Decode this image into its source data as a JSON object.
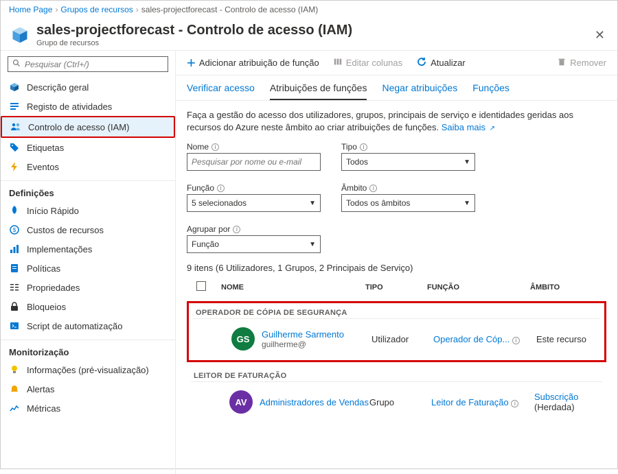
{
  "breadcrumb": {
    "home": "Home Page",
    "group": "Grupos de recursos",
    "current": "sales-projectforecast - Controlo de acesso (IAM)"
  },
  "header": {
    "title": "sales-projectforecast - Controlo de acesso (IAM)",
    "subtitle": "Grupo de recursos"
  },
  "search": {
    "placeholder": "Pesquisar (Ctrl+/)"
  },
  "nav": {
    "items": [
      {
        "label": "Descrição geral"
      },
      {
        "label": "Registo de atividades"
      },
      {
        "label": "Controlo de acesso (IAM)"
      },
      {
        "label": "Etiquetas"
      },
      {
        "label": "Eventos"
      }
    ],
    "section_def": "Definições",
    "def_items": [
      {
        "label": "Início Rápido"
      },
      {
        "label": "Custos de recursos"
      },
      {
        "label": "Implementações"
      },
      {
        "label": "Políticas"
      },
      {
        "label": "Propriedades"
      },
      {
        "label": "Bloqueios"
      },
      {
        "label": "Script de automatização"
      }
    ],
    "section_mon": "Monitorização",
    "mon_items": [
      {
        "label": "Informações (pré-visualização)"
      },
      {
        "label": "Alertas"
      },
      {
        "label": "Métricas"
      }
    ]
  },
  "toolbar": {
    "add": "Adicionar atribuição de função",
    "edit": "Editar colunas",
    "refresh": "Atualizar",
    "remove": "Remover"
  },
  "tabs": {
    "verify": "Verificar acesso",
    "assign": "Atribuições de funções",
    "deny": "Negar atribuições",
    "roles": "Funções"
  },
  "desc": {
    "text": "Faça a gestão do acesso dos utilizadores, grupos, principais de serviço e identidades geridas aos recursos do Azure neste âmbito ao criar atribuições de funções. ",
    "link": "Saiba mais"
  },
  "filters": {
    "nome_label": "Nome",
    "nome_placeholder": "Pesquisar por nome ou e-mail",
    "tipo_label": "Tipo",
    "tipo_value": "Todos",
    "funcao_label": "Função",
    "funcao_value": "5 selecionados",
    "ambito_label": "Âmbito",
    "ambito_value": "Todos os âmbitos",
    "agrupar_label": "Agrupar por",
    "agrupar_value": "Função"
  },
  "summary": "9 itens (6 Utilizadores, 1 Grupos, 2 Principais de Serviço)",
  "cols": {
    "nome": "Nome",
    "tipo": "Tipo",
    "funcao": "Função",
    "ambito": "Âmbito"
  },
  "group1": {
    "title": "OPERADOR DE CÓPIA DE SEGURANÇA",
    "avatar": "GS",
    "name": "Guilherme Sarmento",
    "email": "guilherme@",
    "tipo": "Utilizador",
    "funcao": "Operador de Cóp...",
    "ambito": "Este recurso"
  },
  "group2": {
    "title": "LEITOR DE FATURAÇÃO",
    "avatar": "AV",
    "name": "Administradores de Vendas",
    "tipo": "Grupo",
    "funcao": "Leitor de Faturação",
    "ambito_link": "Subscrição",
    "ambito_suffix": " (Herdada)"
  }
}
